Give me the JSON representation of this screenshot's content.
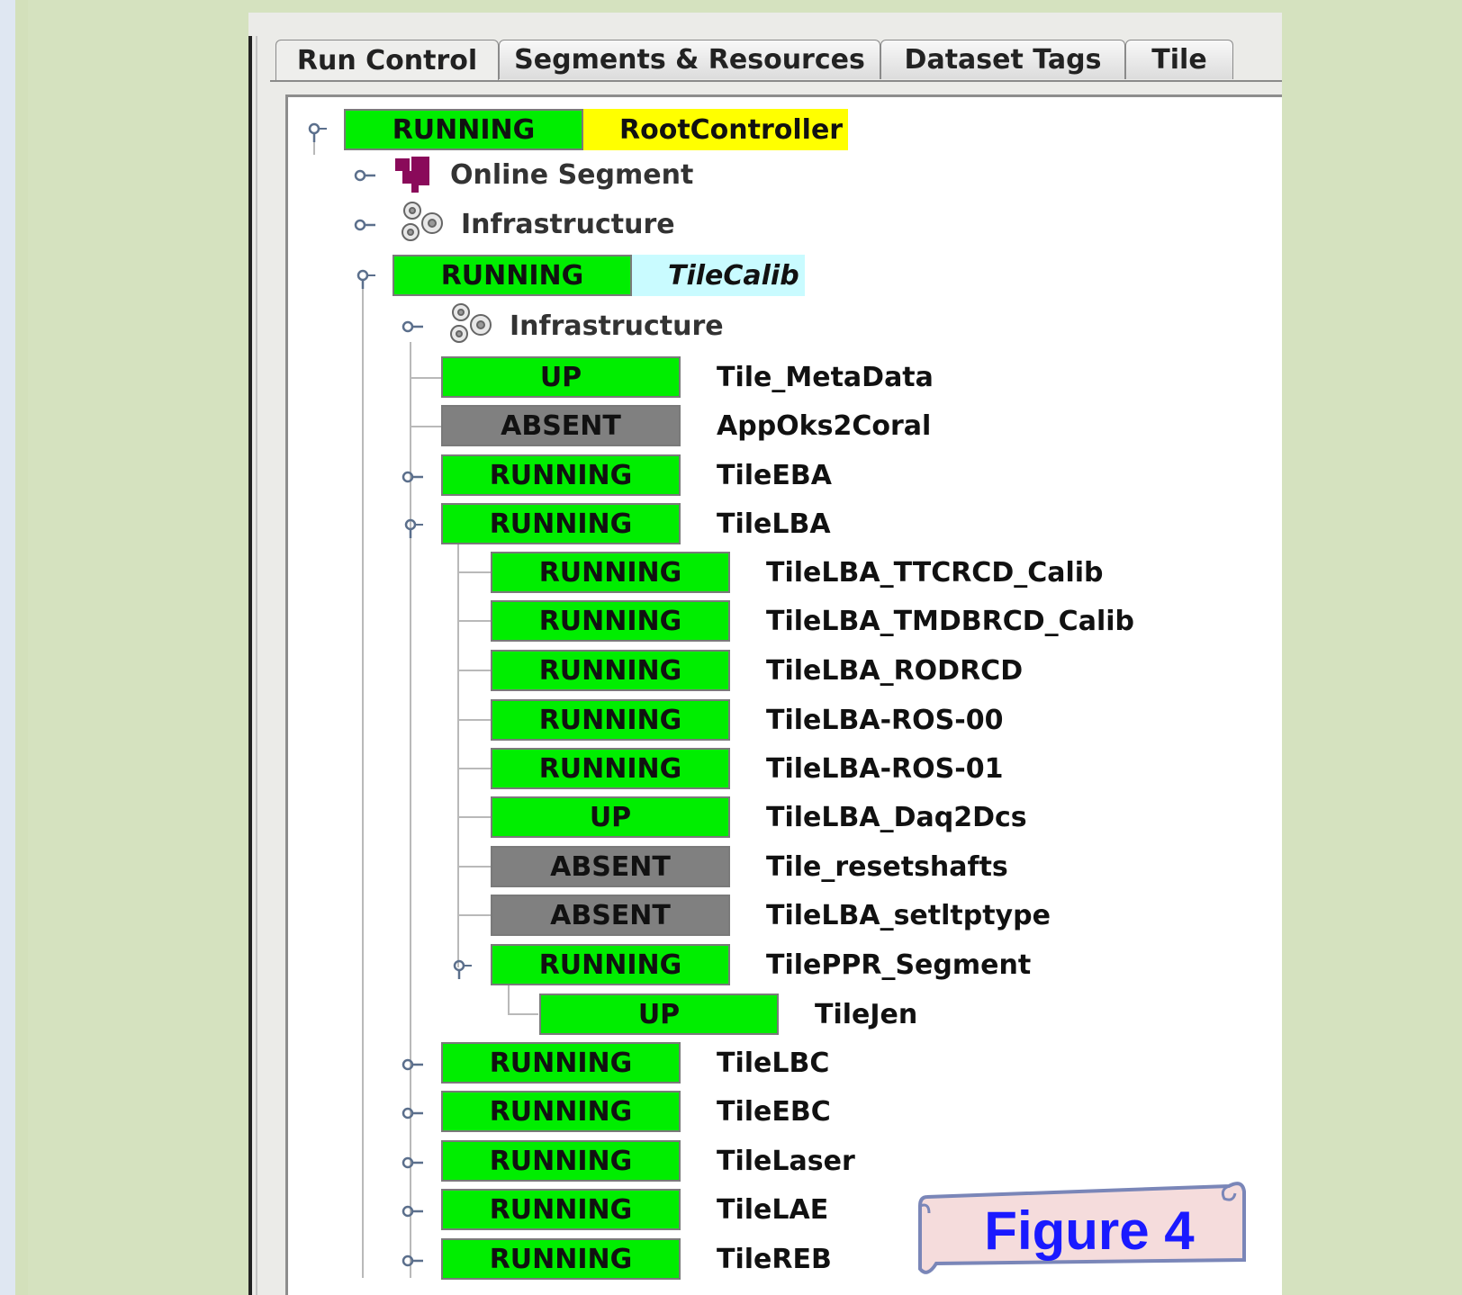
{
  "tabs": [
    "Run Control",
    "Segments & Resources",
    "Dataset Tags",
    "Tile"
  ],
  "colors": {
    "running": "#00ee00",
    "up": "#00ee00",
    "absent": "#808080",
    "highlight_root": "#ffff00",
    "highlight_segment": "#c9fbff",
    "figure_text": "#1a1aff",
    "scroll_fill": "#f5dcdc"
  },
  "tree": {
    "root": {
      "state": "RUNNING",
      "name": "RootController"
    },
    "online_segment": "Online Segment",
    "infrastructure_top": "Infrastructure",
    "tilecalib": {
      "state": "RUNNING",
      "name": "TileCalib"
    },
    "infrastructure_calib": "Infrastructure",
    "calib_children": [
      {
        "state": "UP",
        "name": "Tile_MetaData"
      },
      {
        "state": "ABSENT",
        "name": "AppOks2Coral"
      },
      {
        "state": "RUNNING",
        "name": "TileEBA"
      },
      {
        "state": "RUNNING",
        "name": "TileLBA"
      }
    ],
    "lba_children": [
      {
        "state": "RUNNING",
        "name": "TileLBA_TTCRCD_Calib"
      },
      {
        "state": "RUNNING",
        "name": "TileLBA_TMDBRCD_Calib"
      },
      {
        "state": "RUNNING",
        "name": "TileLBA_RODRCD"
      },
      {
        "state": "RUNNING",
        "name": "TileLBA-ROS-00"
      },
      {
        "state": "RUNNING",
        "name": "TileLBA-ROS-01"
      },
      {
        "state": "UP",
        "name": "TileLBA_Daq2Dcs"
      },
      {
        "state": "ABSENT",
        "name": "Tile_resetshafts"
      },
      {
        "state": "ABSENT",
        "name": "TileLBA_setltptype"
      },
      {
        "state": "RUNNING",
        "name": "TilePPR_Segment"
      }
    ],
    "ppr_child": {
      "state": "UP",
      "name": "TileJen"
    },
    "calib_rest": [
      {
        "state": "RUNNING",
        "name": "TileLBC"
      },
      {
        "state": "RUNNING",
        "name": "TileEBC"
      },
      {
        "state": "RUNNING",
        "name": "TileLaser"
      },
      {
        "state": "RUNNING",
        "name": "TileLAE"
      },
      {
        "state": "RUNNING",
        "name": "TileREB"
      }
    ]
  },
  "figure_label": "Figure 4"
}
